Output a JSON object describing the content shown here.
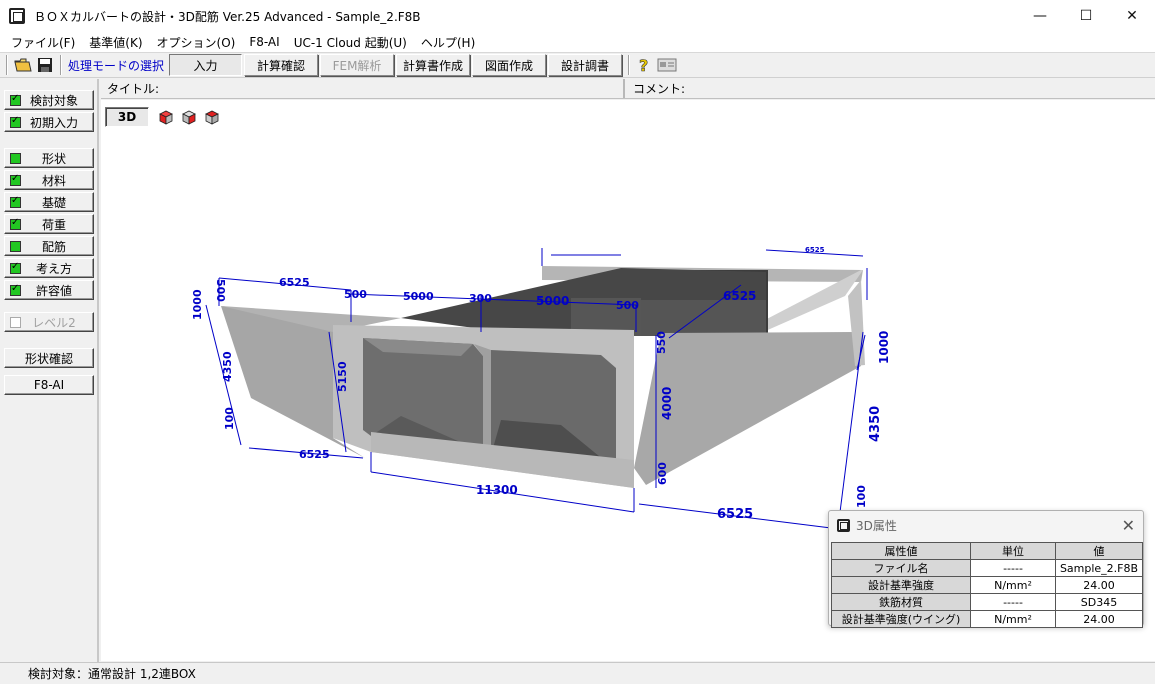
{
  "window": {
    "title": "ＢＯＸカルバートの設計・3D配筋 Ver.25 Advanced - Sample_2.F8B",
    "minimize": "—",
    "maximize": "☐",
    "close": "✕"
  },
  "menu": [
    "ファイル(F)",
    "基準値(K)",
    "オプション(O)",
    "F8-AI",
    "UC-1 Cloud 起動(U)",
    "ヘルプ(H)"
  ],
  "toolbar": {
    "mode_label": "処理モードの選択",
    "buttons": [
      "入力",
      "計算確認",
      "FEM解析",
      "計算書作成",
      "図面作成",
      "設計調書"
    ]
  },
  "sidebar": {
    "items": [
      "検討対象",
      "初期入力",
      "形状",
      "材料",
      "基礎",
      "荷重",
      "配筋",
      "考え方",
      "許容値",
      "レベル2",
      "形状確認",
      "F8-AI"
    ]
  },
  "infobar": {
    "title_label": "タイトル:",
    "comment_label": "コメント:"
  },
  "view": {
    "mode_button": "3D"
  },
  "dimensions": [
    "500",
    "6525",
    "500",
    "5000",
    "300",
    "5000",
    "500",
    "6525",
    "1000",
    "4350",
    "100",
    "5150",
    "550",
    "4000",
    "600",
    "6525",
    "11300",
    "6525",
    "1000",
    "4350",
    "6525",
    "100"
  ],
  "properties": {
    "title": "3D属性",
    "headers": [
      "属性値",
      "単位",
      "値"
    ],
    "rows": [
      {
        "name": "ファイル名",
        "unit": "-----",
        "value": "Sample_2.F8B"
      },
      {
        "name": "設計基準強度",
        "unit": "N/mm²",
        "value": "24.00"
      },
      {
        "name": "鉄筋材質",
        "unit": "-----",
        "value": "SD345"
      },
      {
        "name": "設計基準強度(ウイング)",
        "unit": "N/mm²",
        "value": "24.00"
      }
    ]
  },
  "status": {
    "text": "検討対象：通常設計 1,2連BOX"
  }
}
